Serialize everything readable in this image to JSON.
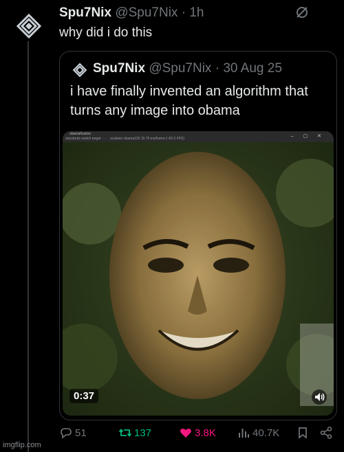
{
  "tweet": {
    "author_name": "Spu7Nix",
    "author_handle": "@Spu7Nix",
    "separator": "·",
    "time": "1h",
    "text": "why did i do this"
  },
  "quoted_tweet": {
    "author_name": "Spu7Nix",
    "author_handle": "@Spu7Nix",
    "separator": "·",
    "date": "30 Aug 25",
    "text": "i have finally invented an algorithm that turns any image into obama",
    "media": {
      "duration": "0:37",
      "app_bar_title": "obamafication",
      "app_bar_subtitle": "standards  switch target  ·  ·  ·  ·      scaletex obama125      15.79 ms/frame (~63.3 FPS)"
    }
  },
  "actions": {
    "replies": "51",
    "reposts": "137",
    "likes": "3.8K",
    "views": "40.7K"
  },
  "watermark": "imgflip.com",
  "colors": {
    "background": "#000000",
    "text_primary": "#e7e9ea",
    "text_secondary": "#71767b",
    "repost_active": "#00ba7c",
    "like_active": "#f91880",
    "border": "#2f3336"
  },
  "icons": {
    "avatar": "sputnix-logo-icon",
    "more": "no-entry-icon",
    "reply": "reply-icon",
    "repost": "repost-icon",
    "like": "heart-icon",
    "views": "analytics-icon",
    "bookmark": "bookmark-icon",
    "share": "share-icon",
    "volume": "volume-icon"
  }
}
